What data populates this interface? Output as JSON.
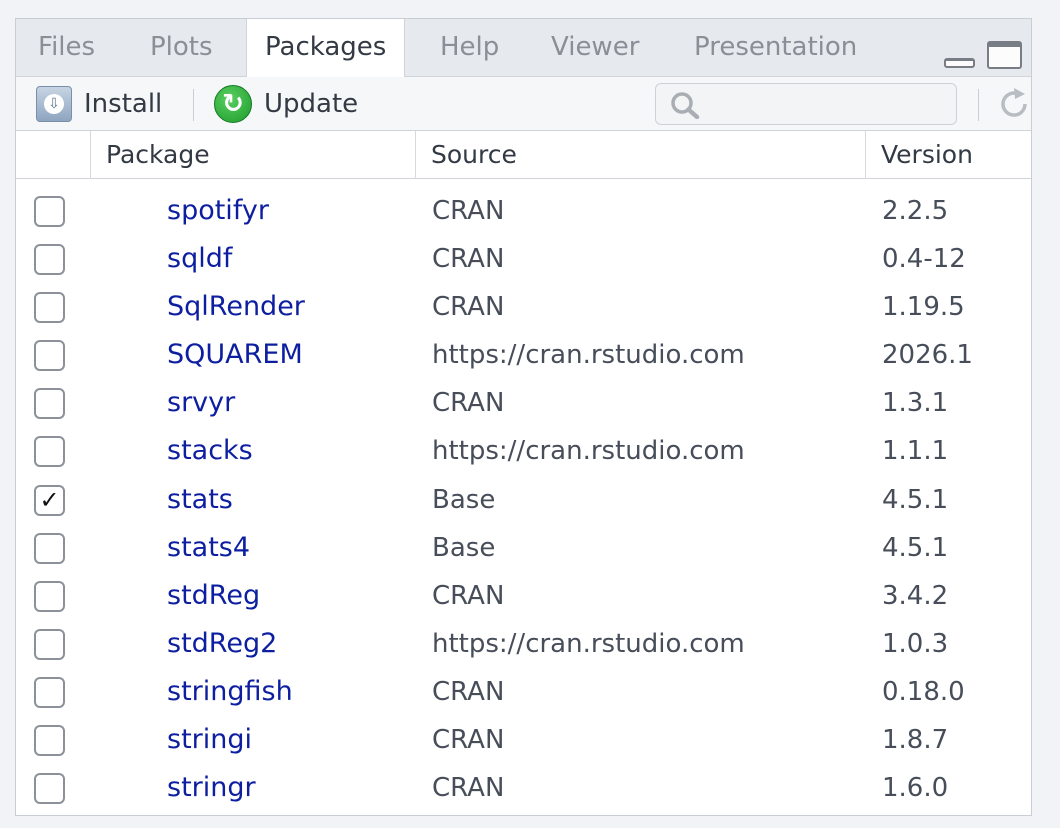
{
  "tabs": [
    {
      "label": "Files",
      "active": false
    },
    {
      "label": "Plots",
      "active": false
    },
    {
      "label": "Packages",
      "active": true
    },
    {
      "label": "Help",
      "active": false
    },
    {
      "label": "Viewer",
      "active": false
    },
    {
      "label": "Presentation",
      "active": false
    }
  ],
  "toolbar": {
    "install_label": "Install",
    "update_label": "Update",
    "search_value": ""
  },
  "table": {
    "headers": {
      "package": "Package",
      "source": "Source",
      "version": "Version"
    },
    "rows": [
      {
        "name": "spotifyr",
        "source": "CRAN",
        "version": "2.2.5",
        "loaded": false
      },
      {
        "name": "sqldf",
        "source": "CRAN",
        "version": "0.4-12",
        "loaded": false
      },
      {
        "name": "SqlRender",
        "source": "CRAN",
        "version": "1.19.5",
        "loaded": false
      },
      {
        "name": "SQUAREM",
        "source": "https://cran.rstudio.com",
        "version": "2026.1",
        "loaded": false
      },
      {
        "name": "srvyr",
        "source": "CRAN",
        "version": "1.3.1",
        "loaded": false
      },
      {
        "name": "stacks",
        "source": "https://cran.rstudio.com",
        "version": "1.1.1",
        "loaded": false
      },
      {
        "name": "stats",
        "source": "Base",
        "version": "4.5.1",
        "loaded": true
      },
      {
        "name": "stats4",
        "source": "Base",
        "version": "4.5.1",
        "loaded": false
      },
      {
        "name": "stdReg",
        "source": "CRAN",
        "version": "3.4.2",
        "loaded": false
      },
      {
        "name": "stdReg2",
        "source": "https://cran.rstudio.com",
        "version": "1.0.3",
        "loaded": false
      },
      {
        "name": "stringfish",
        "source": "CRAN",
        "version": "0.18.0",
        "loaded": false
      },
      {
        "name": "stringi",
        "source": "CRAN",
        "version": "1.8.7",
        "loaded": false
      },
      {
        "name": "stringr",
        "source": "CRAN",
        "version": "1.6.0",
        "loaded": false
      }
    ]
  },
  "colors": {
    "package_link": "#0d1fa0",
    "text": "#474e5a",
    "tabbar_bg": "#e6e9ee"
  },
  "icons": {
    "install": "install-icon",
    "update": "update-icon",
    "search": "search-icon",
    "refresh": "refresh-icon",
    "minimize": "minimize-icon",
    "maximize": "maximize-icon"
  }
}
